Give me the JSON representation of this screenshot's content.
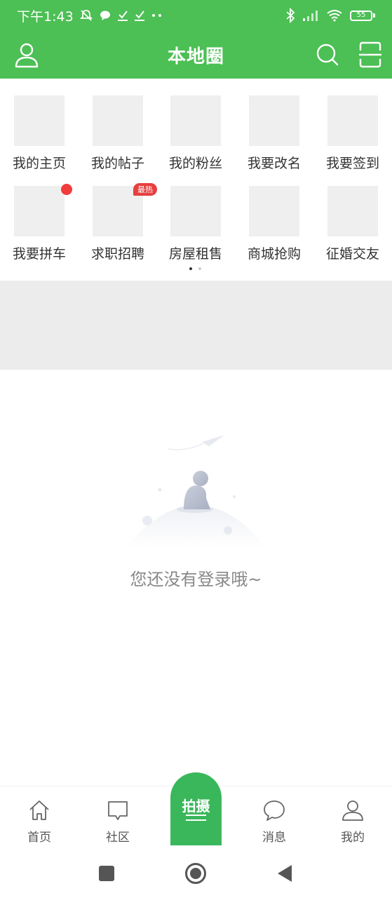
{
  "status_bar": {
    "time": "下午1:43",
    "battery": "55",
    "icons": [
      "mute-icon",
      "chat-bubble-icon",
      "download-icon",
      "download-icon",
      "more-dots-icon",
      "bluetooth-icon",
      "signal-icon",
      "wifi-icon",
      "battery-icon"
    ]
  },
  "header": {
    "title": "本地圈",
    "left_icon": "user-icon",
    "right_icons": [
      "search-icon",
      "scan-icon"
    ],
    "accent": "#4cbf55"
  },
  "menu": {
    "row1": [
      {
        "label": "我的主页"
      },
      {
        "label": "我的帖子"
      },
      {
        "label": "我的粉丝"
      },
      {
        "label": "我要改名"
      },
      {
        "label": "我要签到"
      }
    ],
    "row2": [
      {
        "label": "我要拼车",
        "badge": "red-dot"
      },
      {
        "label": "求职招聘",
        "badge_text": "最热"
      },
      {
        "label": "房屋租售"
      },
      {
        "label": "商城抢购"
      },
      {
        "label": "征婚交友"
      }
    ],
    "pager_dots": 2,
    "pager_active": 1
  },
  "empty_state": {
    "message": "您还没有登录哦~",
    "illustration": "person-sitting-on-planet-illustration"
  },
  "bottom_nav": {
    "items": [
      {
        "label": "首页",
        "icon": "home-icon"
      },
      {
        "label": "社区",
        "icon": "community-icon"
      },
      {
        "label": "消息",
        "icon": "message-icon"
      },
      {
        "label": "我的",
        "icon": "profile-icon"
      }
    ],
    "center_button": {
      "label": "拍摄",
      "color": "#3bb75b"
    }
  },
  "system_nav": [
    "recents-button",
    "home-button",
    "back-button"
  ]
}
